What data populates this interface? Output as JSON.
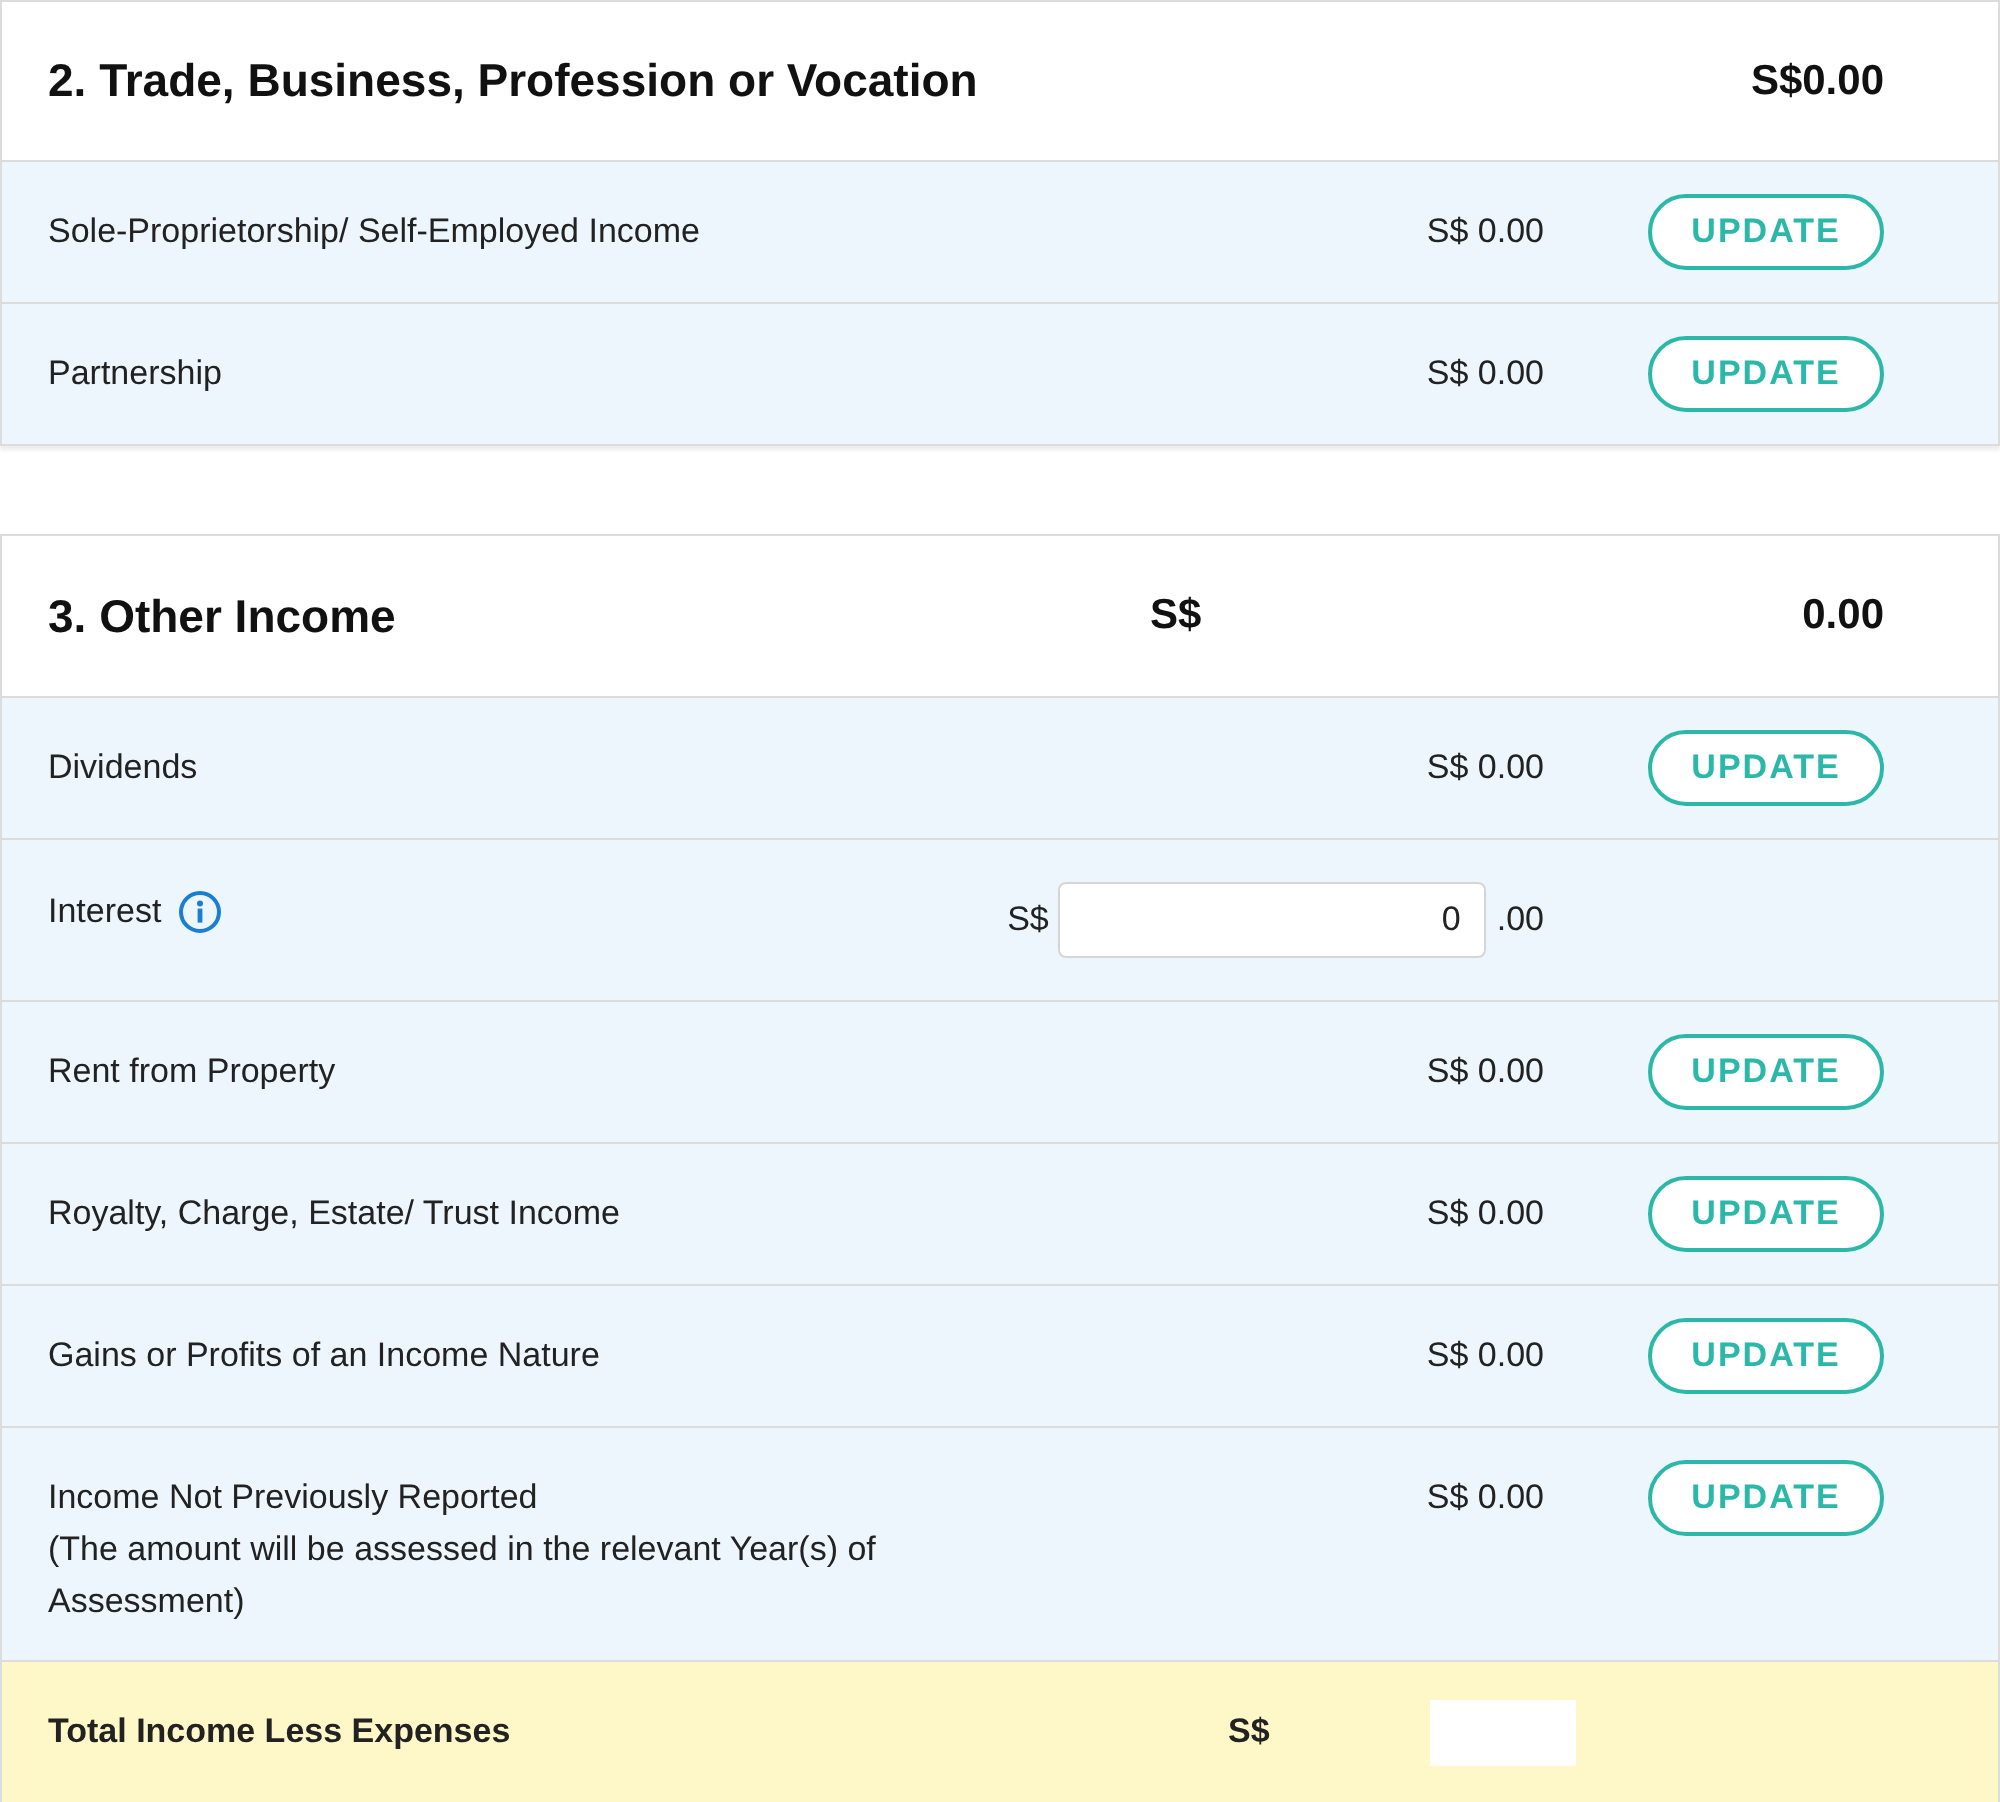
{
  "sections": [
    {
      "title": "2. Trade, Business, Profession or Vocation",
      "total": "S$0.00",
      "rows": [
        {
          "kind": "amount",
          "label": "Sole-Proprietorship/ Self-Employed Income",
          "info": false,
          "amount": "S$ 0.00",
          "button": "UPDATE"
        },
        {
          "kind": "amount",
          "label": "Partnership",
          "info": false,
          "amount": "S$ 0.00",
          "button": "UPDATE"
        }
      ]
    },
    {
      "title": "3. Other Income",
      "currency": "S$",
      "total": "0.00",
      "rows": [
        {
          "kind": "amount",
          "label": "Dividends",
          "info": false,
          "amount": "S$ 0.00",
          "button": "UPDATE"
        },
        {
          "kind": "input",
          "label": "Interest",
          "info": true,
          "currency": "S$",
          "value": "0",
          "decimals": ".00"
        },
        {
          "kind": "amount",
          "label": "Rent from Property",
          "info": false,
          "amount": "S$ 0.00",
          "button": "UPDATE"
        },
        {
          "kind": "amount",
          "label": "Royalty, Charge, Estate/ Trust Income",
          "info": false,
          "amount": "S$ 0.00",
          "button": "UPDATE"
        },
        {
          "kind": "amount",
          "label": "Gains or Profits of an Income Nature",
          "info": false,
          "amount": "S$ 0.00",
          "button": "UPDATE"
        },
        {
          "kind": "amount",
          "label": "Income Not Previously Reported",
          "note": "(The amount will be assessed in the relevant Year(s) of Assessment)",
          "info": false,
          "amount": "S$ 0.00",
          "button": "UPDATE"
        }
      ]
    }
  ],
  "footer": {
    "label": "Total Income Less Expenses",
    "currency": "S$"
  }
}
